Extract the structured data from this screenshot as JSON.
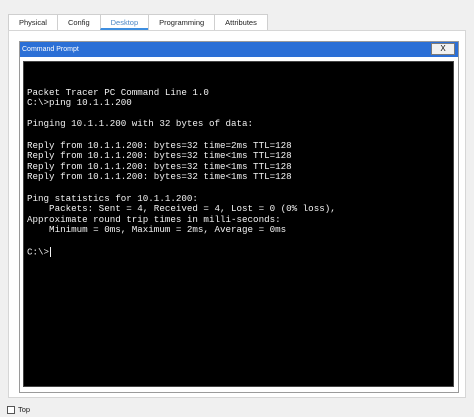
{
  "tabs": [
    {
      "label": "Physical",
      "active": false
    },
    {
      "label": "Config",
      "active": false
    },
    {
      "label": "Desktop",
      "active": true
    },
    {
      "label": "Programming",
      "active": false
    },
    {
      "label": "Attributes",
      "active": false
    }
  ],
  "cmd_window": {
    "title": "Command Prompt",
    "close_label": "X"
  },
  "terminal": {
    "lines": [
      "",
      "Packet Tracer PC Command Line 1.0",
      "C:\\>ping 10.1.1.200",
      "",
      "Pinging 10.1.1.200 with 32 bytes of data:",
      "",
      "Reply from 10.1.1.200: bytes=32 time=2ms TTL=128",
      "Reply from 10.1.1.200: bytes=32 time<1ms TTL=128",
      "Reply from 10.1.1.200: bytes=32 time<1ms TTL=128",
      "Reply from 10.1.1.200: bytes=32 time<1ms TTL=128",
      "",
      "Ping statistics for 10.1.1.200:",
      "    Packets: Sent = 4, Received = 4, Lost = 0 (0% loss),",
      "Approximate round trip times in milli-seconds:",
      "    Minimum = 0ms, Maximum = 2ms, Average = 0ms",
      ""
    ],
    "prompt": "C:\\>"
  },
  "footer": {
    "top_label": "Top",
    "top_checked": false
  },
  "colors": {
    "titlebar": "#2b6fd6",
    "terminal_bg": "#000000",
    "terminal_text": "#f2f2f2",
    "active_tab": "#3d8ee0"
  }
}
